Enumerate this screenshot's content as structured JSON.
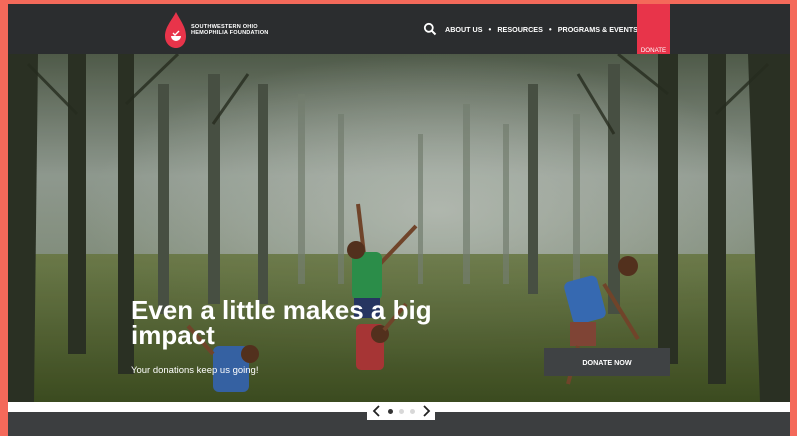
{
  "logo": {
    "line1": "SOUTHWESTERN OHIO",
    "line2": "HEMOPHILIA FOUNDATION"
  },
  "nav": {
    "search_icon": "search-icon",
    "items": [
      "ABOUT US",
      "RESOURCES",
      "PROGRAMS & EVENTS"
    ],
    "separator": "•"
  },
  "donate_tab": {
    "label": "DONATE",
    "color": "#e8344a"
  },
  "hero": {
    "headline": "Even a little makes a big impact",
    "subheadline": "Your donations keep us going!",
    "cta_label": "DONATE NOW"
  },
  "carousel": {
    "prev_icon": "chevron-left-icon",
    "next_icon": "chevron-right-icon",
    "slides": 3,
    "active_slide": 1
  },
  "colors": {
    "page_border": "#f4695a",
    "header_bg": "#2b2d2f",
    "accent_red": "#e8344a",
    "cta_bg": "#3f4244"
  }
}
